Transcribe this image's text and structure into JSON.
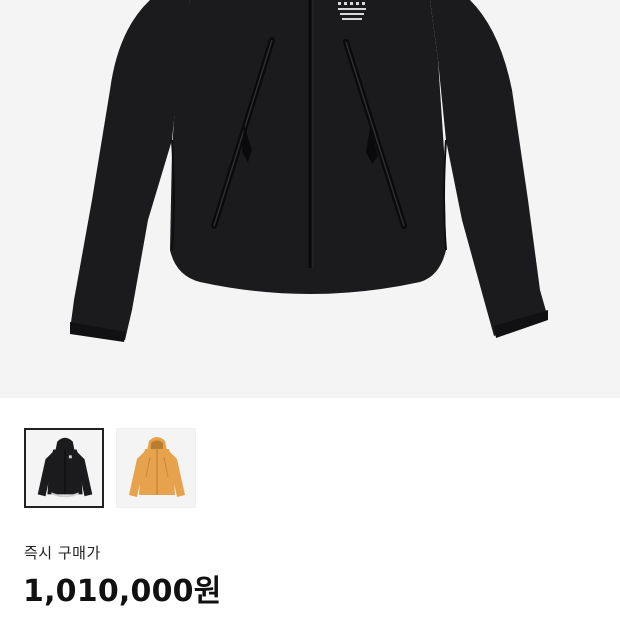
{
  "product": {
    "image_alt_icon": "jacket-icon",
    "colors": {
      "background": "#f4f4f4",
      "jacket_black": "#1b1b1e",
      "jacket_orange": "#e6a24c",
      "selected_border": "#222222"
    },
    "thumbnails": [
      {
        "name": "black-jacket-thumbnail",
        "selected": true
      },
      {
        "name": "orange-jacket-thumbnail",
        "selected": false
      }
    ]
  },
  "price": {
    "label": "즉시 구매가",
    "value": "1,010,000원"
  }
}
